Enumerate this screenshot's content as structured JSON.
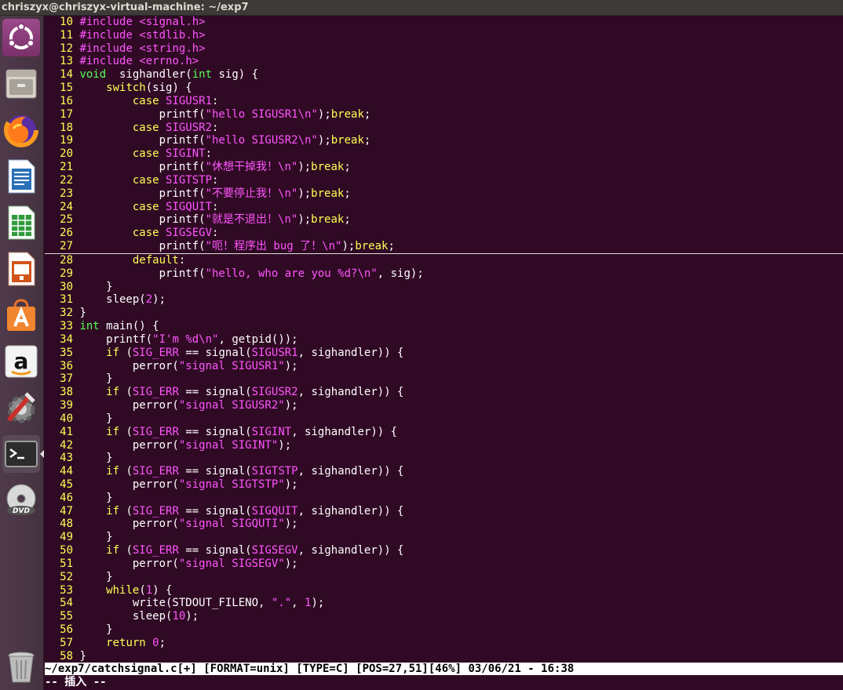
{
  "window": {
    "title": "chriszyx@chriszyx-virtual-machine: ~/exp7"
  },
  "launcher": {
    "items": [
      {
        "name": "ubuntu-dash-icon"
      },
      {
        "name": "files-icon"
      },
      {
        "name": "firefox-icon"
      },
      {
        "name": "libreoffice-writer-icon"
      },
      {
        "name": "libreoffice-calc-icon"
      },
      {
        "name": "libreoffice-impress-icon"
      },
      {
        "name": "software-center-icon"
      },
      {
        "name": "amazon-icon"
      },
      {
        "name": "system-settings-icon"
      },
      {
        "name": "terminal-icon"
      },
      {
        "name": "dvd-icon"
      },
      {
        "name": "trash-icon"
      }
    ]
  },
  "colors": {
    "background": "#300a24",
    "line_number": "#ffff55",
    "keyword": "#ffff55",
    "string": "#ff55ff",
    "type": "#55ff55",
    "text": "#ffffff"
  },
  "editor": {
    "lines": [
      {
        "n": "10",
        "segs": [
          [
            " ",
            ""
          ],
          [
            "pp",
            "#include"
          ],
          [
            " ",
            ""
          ],
          [
            "str",
            "<signal.h>"
          ]
        ]
      },
      {
        "n": "11",
        "segs": [
          [
            " ",
            ""
          ],
          [
            "pp",
            "#include"
          ],
          [
            " ",
            ""
          ],
          [
            "str",
            "<stdlib.h>"
          ]
        ]
      },
      {
        "n": "12",
        "segs": [
          [
            " ",
            ""
          ],
          [
            "pp",
            "#include"
          ],
          [
            " ",
            ""
          ],
          [
            "str",
            "<string.h>"
          ]
        ]
      },
      {
        "n": "13",
        "segs": [
          [
            " ",
            ""
          ],
          [
            "pp",
            "#include"
          ],
          [
            " ",
            ""
          ],
          [
            "str",
            "<errno.h>"
          ]
        ]
      },
      {
        "n": "14",
        "segs": [
          [
            " ",
            ""
          ],
          [
            "ty",
            "void"
          ],
          [
            "",
            "  sighandler("
          ],
          [
            "ty",
            "int"
          ],
          [
            "",
            " sig) {"
          ]
        ]
      },
      {
        "n": "15",
        "segs": [
          [
            "",
            "     "
          ],
          [
            "kw",
            "switch"
          ],
          [
            "",
            "(sig) {"
          ]
        ]
      },
      {
        "n": "16",
        "segs": [
          [
            "",
            "         "
          ],
          [
            "kw",
            "case"
          ],
          [
            "",
            " "
          ],
          [
            "str",
            "SIGUSR1"
          ],
          [
            "",
            ":"
          ]
        ]
      },
      {
        "n": "17",
        "segs": [
          [
            "",
            "             printf("
          ],
          [
            "str",
            "\"hello SIGUSR1"
          ],
          [
            "sp",
            "\\n"
          ],
          [
            "str",
            "\""
          ],
          [
            "",
            ");"
          ],
          [
            "kw",
            "break"
          ],
          [
            "",
            ";"
          ]
        ]
      },
      {
        "n": "18",
        "segs": [
          [
            "",
            "         "
          ],
          [
            "kw",
            "case"
          ],
          [
            "",
            " "
          ],
          [
            "str",
            "SIGUSR2"
          ],
          [
            "",
            ":"
          ]
        ]
      },
      {
        "n": "19",
        "segs": [
          [
            "",
            "             printf("
          ],
          [
            "str",
            "\"hello SIGUSR2"
          ],
          [
            "sp",
            "\\n"
          ],
          [
            "str",
            "\""
          ],
          [
            "",
            ");"
          ],
          [
            "kw",
            "break"
          ],
          [
            "",
            ";"
          ]
        ]
      },
      {
        "n": "20",
        "segs": [
          [
            "",
            "         "
          ],
          [
            "kw",
            "case"
          ],
          [
            "",
            " "
          ],
          [
            "str",
            "SIGINT"
          ],
          [
            "",
            ":"
          ]
        ]
      },
      {
        "n": "21",
        "segs": [
          [
            "",
            "             printf("
          ],
          [
            "str",
            "\"休想干掉我！"
          ],
          [
            "sp",
            "\\n"
          ],
          [
            "str",
            "\""
          ],
          [
            "",
            ");"
          ],
          [
            "kw",
            "break"
          ],
          [
            "",
            ";"
          ]
        ]
      },
      {
        "n": "22",
        "segs": [
          [
            "",
            "         "
          ],
          [
            "kw",
            "case"
          ],
          [
            "",
            " "
          ],
          [
            "str",
            "SIGTSTP"
          ],
          [
            "",
            ":"
          ]
        ]
      },
      {
        "n": "23",
        "segs": [
          [
            "",
            "             printf("
          ],
          [
            "str",
            "\"不要停止我！"
          ],
          [
            "sp",
            "\\n"
          ],
          [
            "str",
            "\""
          ],
          [
            "",
            ");"
          ],
          [
            "kw",
            "break"
          ],
          [
            "",
            ";"
          ]
        ]
      },
      {
        "n": "24",
        "segs": [
          [
            "",
            "         "
          ],
          [
            "kw",
            "case"
          ],
          [
            "",
            " "
          ],
          [
            "str",
            "SIGQUIT"
          ],
          [
            "",
            ":"
          ]
        ]
      },
      {
        "n": "25",
        "segs": [
          [
            "",
            "             printf("
          ],
          [
            "str",
            "\"就是不退出！"
          ],
          [
            "sp",
            "\\n"
          ],
          [
            "str",
            "\""
          ],
          [
            "",
            ");"
          ],
          [
            "kw",
            "break"
          ],
          [
            "",
            ";"
          ]
        ]
      },
      {
        "n": "26",
        "segs": [
          [
            "",
            "         "
          ],
          [
            "kw",
            "case"
          ],
          [
            "",
            " "
          ],
          [
            "str",
            "SIGSEGV"
          ],
          [
            "",
            ":"
          ]
        ]
      },
      {
        "n": "27",
        "cursor": true,
        "segs": [
          [
            "",
            "             printf("
          ],
          [
            "str",
            "\"呃！程序出 bug 了！"
          ],
          [
            "sp",
            "\\n"
          ],
          [
            "str",
            "\""
          ],
          [
            "",
            ");"
          ],
          [
            "kw",
            "break"
          ],
          [
            "",
            ";"
          ]
        ]
      },
      {
        "n": "28",
        "segs": [
          [
            "",
            "         "
          ],
          [
            "kw",
            "default"
          ],
          [
            "",
            ":"
          ]
        ]
      },
      {
        "n": "29",
        "segs": [
          [
            "",
            "             printf("
          ],
          [
            "str",
            "\"hello, who are you %d?"
          ],
          [
            "sp",
            "\\n"
          ],
          [
            "str",
            "\""
          ],
          [
            "",
            ", sig);"
          ]
        ]
      },
      {
        "n": "30",
        "segs": [
          [
            "",
            "     }"
          ]
        ]
      },
      {
        "n": "31",
        "segs": [
          [
            "",
            "     sleep("
          ],
          [
            "num",
            "2"
          ],
          [
            "",
            ");"
          ]
        ]
      },
      {
        "n": "32",
        "segs": [
          [
            "",
            ""
          ],
          [
            "",
            "}"
          ]
        ]
      },
      {
        "n": "33",
        "segs": [
          [
            " ",
            ""
          ],
          [
            "ty",
            "int"
          ],
          [
            "",
            " main() {"
          ]
        ]
      },
      {
        "n": "34",
        "segs": [
          [
            "",
            "     printf("
          ],
          [
            "str",
            "\"I'm "
          ],
          [
            "sp",
            "%d\\n"
          ],
          [
            "str",
            "\""
          ],
          [
            "",
            ", getpid());"
          ]
        ]
      },
      {
        "n": "35",
        "segs": [
          [
            "",
            "     "
          ],
          [
            "kw",
            "if"
          ],
          [
            "",
            " ("
          ],
          [
            "str",
            "SIG_ERR"
          ],
          [
            "",
            " == signal("
          ],
          [
            "str",
            "SIGUSR1"
          ],
          [
            "",
            ", sighandler)) {"
          ]
        ]
      },
      {
        "n": "36",
        "segs": [
          [
            "",
            "         perror("
          ],
          [
            "str",
            "\"signal SIGUSR1\""
          ],
          [
            "",
            ");"
          ]
        ]
      },
      {
        "n": "37",
        "segs": [
          [
            "",
            "     }"
          ]
        ]
      },
      {
        "n": "38",
        "segs": [
          [
            "",
            "     "
          ],
          [
            "kw",
            "if"
          ],
          [
            "",
            " ("
          ],
          [
            "str",
            "SIG_ERR"
          ],
          [
            "",
            " == signal("
          ],
          [
            "str",
            "SIGUSR2"
          ],
          [
            "",
            ", sighandler)) {"
          ]
        ]
      },
      {
        "n": "39",
        "segs": [
          [
            "",
            "         perror("
          ],
          [
            "str",
            "\"signal SIGUSR2\""
          ],
          [
            "",
            ");"
          ]
        ]
      },
      {
        "n": "40",
        "segs": [
          [
            "",
            "     }"
          ]
        ]
      },
      {
        "n": "41",
        "segs": [
          [
            "",
            "     "
          ],
          [
            "kw",
            "if"
          ],
          [
            "",
            " ("
          ],
          [
            "str",
            "SIG_ERR"
          ],
          [
            "",
            " == signal("
          ],
          [
            "str",
            "SIGINT"
          ],
          [
            "",
            ", sighandler)) {"
          ]
        ]
      },
      {
        "n": "42",
        "segs": [
          [
            "",
            "         perror("
          ],
          [
            "str",
            "\"signal SIGINT\""
          ],
          [
            "",
            ");"
          ]
        ]
      },
      {
        "n": "43",
        "segs": [
          [
            "",
            "     }"
          ]
        ]
      },
      {
        "n": "44",
        "segs": [
          [
            "",
            "     "
          ],
          [
            "kw",
            "if"
          ],
          [
            "",
            " ("
          ],
          [
            "str",
            "SIG_ERR"
          ],
          [
            "",
            " == signal("
          ],
          [
            "str",
            "SIGTSTP"
          ],
          [
            "",
            ", sighandler)) {"
          ]
        ]
      },
      {
        "n": "45",
        "segs": [
          [
            "",
            "         perror("
          ],
          [
            "str",
            "\"signal SIGTSTP\""
          ],
          [
            "",
            ");"
          ]
        ]
      },
      {
        "n": "46",
        "segs": [
          [
            "",
            "     }"
          ]
        ]
      },
      {
        "n": "47",
        "segs": [
          [
            "",
            "     "
          ],
          [
            "kw",
            "if"
          ],
          [
            "",
            " ("
          ],
          [
            "str",
            "SIG_ERR"
          ],
          [
            "",
            " == signal("
          ],
          [
            "str",
            "SIGQUIT"
          ],
          [
            "",
            ", sighandler)) {"
          ]
        ]
      },
      {
        "n": "48",
        "segs": [
          [
            "",
            "         perror("
          ],
          [
            "str",
            "\"signal SIGQUTI\""
          ],
          [
            "",
            ");"
          ]
        ]
      },
      {
        "n": "49",
        "segs": [
          [
            "",
            "     }"
          ]
        ]
      },
      {
        "n": "50",
        "segs": [
          [
            "",
            "     "
          ],
          [
            "kw",
            "if"
          ],
          [
            "",
            " ("
          ],
          [
            "str",
            "SIG_ERR"
          ],
          [
            "",
            " == signal("
          ],
          [
            "str",
            "SIGSEGV"
          ],
          [
            "",
            ", sighandler)) {"
          ]
        ]
      },
      {
        "n": "51",
        "segs": [
          [
            "",
            "         perror("
          ],
          [
            "str",
            "\"signal SIGSEGV\""
          ],
          [
            "",
            ");"
          ]
        ]
      },
      {
        "n": "52",
        "segs": [
          [
            "",
            "     }"
          ]
        ]
      },
      {
        "n": "53",
        "segs": [
          [
            "",
            "     "
          ],
          [
            "kw",
            "while"
          ],
          [
            "",
            "("
          ],
          [
            "num",
            "1"
          ],
          [
            "",
            ") {"
          ]
        ]
      },
      {
        "n": "54",
        "segs": [
          [
            "",
            "         write(STDOUT_FILENO, "
          ],
          [
            "str",
            "\".\""
          ],
          [
            "",
            ", "
          ],
          [
            "num",
            "1"
          ],
          [
            "",
            ");"
          ]
        ]
      },
      {
        "n": "55",
        "segs": [
          [
            "",
            "         sleep("
          ],
          [
            "num",
            "10"
          ],
          [
            "",
            ");"
          ]
        ]
      },
      {
        "n": "56",
        "segs": [
          [
            "",
            "     }"
          ]
        ]
      },
      {
        "n": "57",
        "segs": [
          [
            "",
            "     "
          ],
          [
            "kw",
            "return"
          ],
          [
            "",
            " "
          ],
          [
            "num",
            "0"
          ],
          [
            "",
            ";"
          ]
        ]
      },
      {
        "n": "58",
        "segs": [
          [
            "",
            ""
          ],
          [
            "",
            "}"
          ]
        ]
      }
    ]
  },
  "statusline": {
    "text": "~/exp7/catchsignal.c[+] [FORMAT=unix] [TYPE=C] [POS=27,51][46%] 03/06/21 - 16:38"
  },
  "modeline": {
    "text": "-- 插入 --"
  }
}
